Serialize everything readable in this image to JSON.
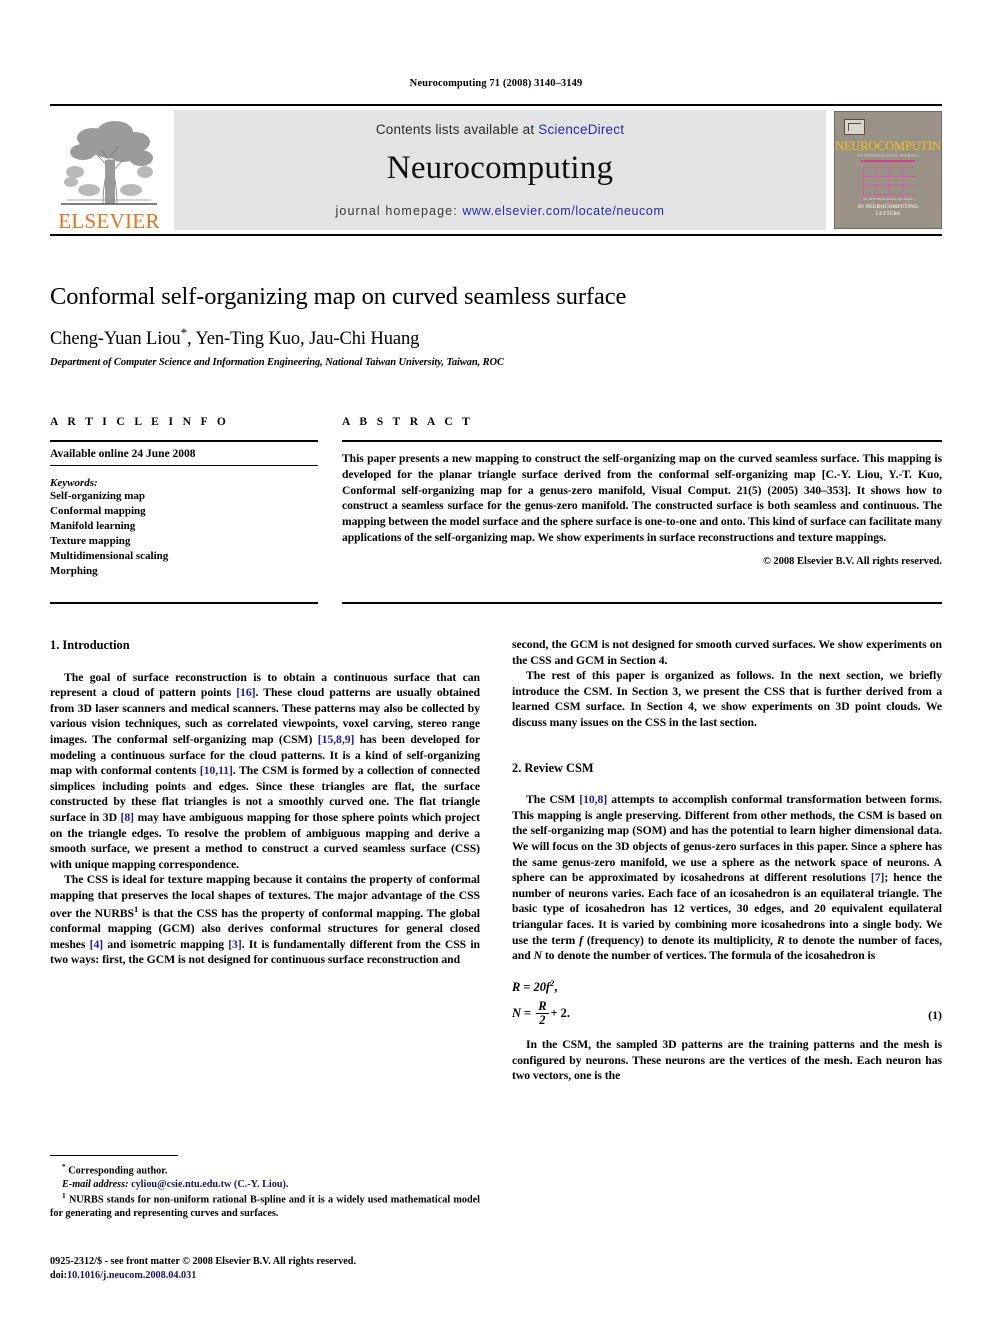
{
  "running_head": "Neurocomputing 71 (2008) 3140–3149",
  "masthead": {
    "contents_prefix": "Contents lists available at ",
    "sciencedirect_label": "ScienceDirect",
    "journal_title": "Neurocomputing",
    "homepage_prefix": "journal homepage: ",
    "homepage_url": "www.elsevier.com/locate/neucom",
    "publisher_wordmark": "ELSEVIER",
    "publisher_logo_icon": "elsevier-tree-icon",
    "cover": {
      "brand_mark_icon": "elsevier-tree-mark-icon",
      "title": "NEUROCOMPUTING",
      "subtitle": "AN INTERNATIONAL JOURNAL",
      "footer_small": "AN INTERNATIONAL JOURNAL",
      "footer_line1": "IN NEUROCOMPUTING",
      "footer_line2": "LETTERS"
    },
    "colors": {
      "link_blue": "#2a2ab0",
      "elsevier_orange": "#e8721b",
      "panel_gray": "#e3e3e3",
      "cover_bg": "#9a9287",
      "cover_title_yellow": "#f0c020",
      "cover_grid_pink": "#d0609e"
    }
  },
  "title_block": {
    "title": "Conformal self-organizing map on curved seamless surface",
    "authors": "Cheng-Yuan Liou",
    "corresponding_marker": "*",
    "authors_rest": ", Yen-Ting Kuo, Jau-Chi Huang",
    "affiliation": "Department of Computer Science and Information Engineering, National Taiwan University, Taiwan, ROC"
  },
  "article_info": {
    "heading": "A R T I C L E   I N F O",
    "available_online": "Available online 24 June 2008",
    "keywords_label": "Keywords:",
    "keywords": [
      "Self-organizing map",
      "Conformal mapping",
      "Manifold learning",
      "Texture mapping",
      "Multidimensional scaling",
      "Morphing"
    ]
  },
  "abstract": {
    "heading": "A B S T R A C T",
    "text": "This paper presents a new mapping to construct the self-organizing map on the curved seamless surface. This mapping is developed for the planar triangle surface derived from the conformal self-organizing map [C.-Y. Liou, Y.-T. Kuo, Conformal self-organizing map for a genus-zero manifold, Visual Comput. 21(5) (2005) 340–353]. It shows how to construct a seamless surface for the genus-zero manifold. The constructed surface is both seamless and continuous. The mapping between the model surface and the sphere surface is one-to-one and onto. This kind of surface can facilitate many applications of the self-organizing map. We show experiments in surface reconstructions and texture mappings.",
    "copyright": "© 2008 Elsevier B.V. All rights reserved."
  },
  "body": {
    "section1_heading": "1.  Introduction",
    "s1_p1_a": "The goal of surface reconstruction is to obtain a continuous surface that can represent a cloud of pattern points ",
    "s1_p1_r1": "[16]",
    "s1_p1_b": ". These cloud patterns are usually obtained from 3D laser scanners and medical scanners. These patterns may also be collected by various vision techniques, such as correlated viewpoints, voxel carving, stereo range images. The conformal self-organizing map (CSM) ",
    "s1_p1_r2": "[15,8,9]",
    "s1_p1_c": " has been developed for modeling a continuous surface for the cloud patterns. It is a kind of self-organizing map with conformal contents ",
    "s1_p1_r3": "[10,11]",
    "s1_p1_d": ". The CSM is formed by a collection of connected simplices including points and edges. Since these triangles are flat, the surface constructed by these flat triangles is not a smoothly curved one. The flat triangle surface in 3D ",
    "s1_p1_r4": "[8]",
    "s1_p1_e": " may have ambiguous mapping for those sphere points which project on the triangle edges. To resolve the problem of ambiguous mapping and derive a smooth surface, we present a method to construct a curved seamless surface (CSS) with unique mapping correspondence.",
    "s1_p2_a": "The CSS is ideal for texture mapping because it contains the property of conformal mapping that preserves the local shapes of textures. The major advantage of the CSS over the NURBS",
    "s1_p2_sup": "1",
    "s1_p2_b": " is that the CSS has the property of conformal mapping. The global conformal mapping (GCM) also derives conformal structures for general closed meshes ",
    "s1_p2_r1": "[4]",
    "s1_p2_c": " and isometric mapping ",
    "s1_p2_r2": "[3]",
    "s1_p2_d": ". It is fundamentally different from the CSS in two ways: first, the GCM is not designed for continuous surface reconstruction and",
    "s1_p3": "second, the GCM is not designed for smooth curved surfaces. We show experiments on the CSS and GCM in Section 4.",
    "s1_p4": "The rest of this paper is organized as follows. In the next section, we briefly introduce the CSM. In Section 3, we present the CSS that is further derived from a learned CSM surface. In Section 4, we show experiments on 3D point clouds. We discuss many issues on the CSS in the last section.",
    "section2_heading": "2.  Review CSM",
    "s2_p1_a": "The CSM ",
    "s2_p1_r1": "[10,8]",
    "s2_p1_b": " attempts to accomplish conformal transformation between forms. This mapping is angle preserving. Different from other methods, the CSM is based on the self-organizing map (SOM) and has the potential to learn higher dimensional data. We will focus on the 3D objects of genus-zero surfaces in this paper. Since a sphere has the same genus-zero manifold, we use a sphere as the network space of neurons. A sphere can be approximated by icosahedrons at different resolutions ",
    "s2_p1_r2": "[7]",
    "s2_p1_c": "; hence the number of neurons varies. Each face of an icosahedron is an equilateral triangle. The basic type of icosahedron has 12 vertices, 30 edges, and 20 equivalent equilateral triangular faces. It is varied by combining more icosahedrons into a single body. We use the term ",
    "s2_p1_f": "f",
    "s2_p1_d": " (frequency) to denote its multiplicity, ",
    "s2_p1_R": "R",
    "s2_p1_e": " to denote the number of faces, and ",
    "s2_p1_N": "N",
    "s2_p1_g": " to denote the number of vertices. The formula of the icosahedron is",
    "equation": {
      "line1_lhs": "R",
      "line1_eq": " = ",
      "line1_rhs": "20f",
      "line1_exp": "2",
      "line1_tail": ",",
      "line2_lhs": "N",
      "line2_eq": " = ",
      "line2_num": "R",
      "line2_den": "2",
      "line2_tail": "+ 2.",
      "number": "(1)"
    },
    "s2_p2": "In the CSM, the sampled 3D patterns are the training patterns and the mesh is configured by neurons. These neurons are the vertices of the mesh. Each neuron has two vectors, one is the"
  },
  "footnotes": {
    "corresponding_marker": "*",
    "corresponding_text": " Corresponding author.",
    "email_label": "E-mail address:",
    "email_value": " cyliou@csie.ntu.edu.tw (C.-Y. Liou).",
    "nurbs_marker": "1",
    "nurbs_text": " NURBS stands for non-uniform rational B-spline and it is a widely used mathematical model for generating and representing curves and surfaces."
  },
  "imprint": {
    "line1": "0925-2312/$ - see front matter © 2008 Elsevier B.V. All rights reserved.",
    "doi_label": "doi:",
    "doi_value": "10.1016/j.neucom.2008.04.031"
  }
}
